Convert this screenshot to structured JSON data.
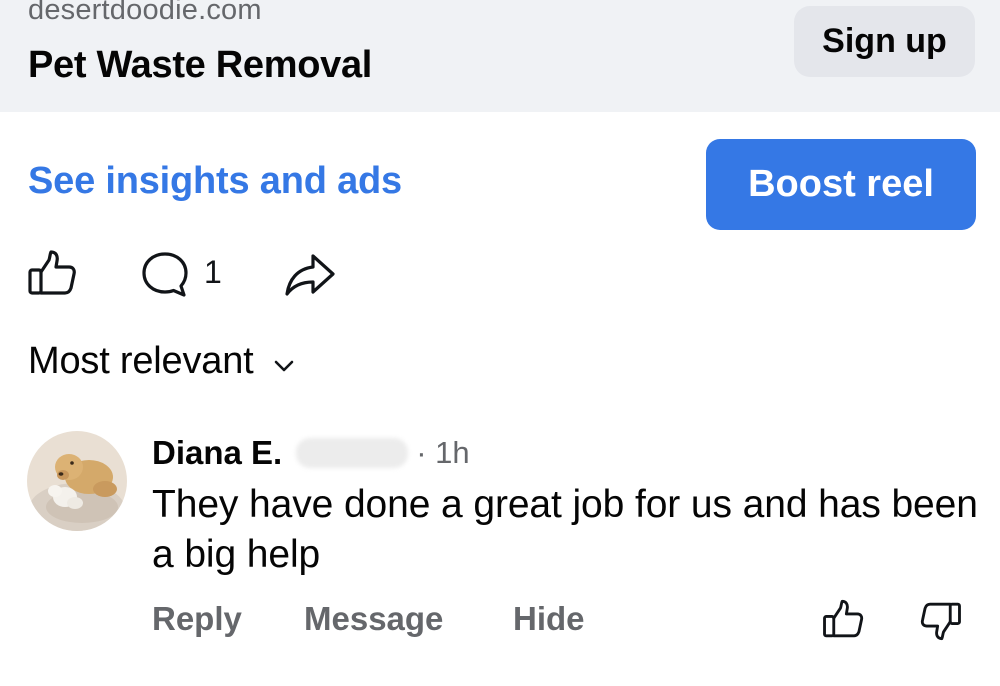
{
  "header": {
    "domain": "desertdoodie.com",
    "page_name": "Pet Waste Removal",
    "signup_label": "Sign up"
  },
  "actions_bar": {
    "insights_label": "See insights and ads",
    "boost_label": "Boost reel",
    "comment_count": "1",
    "icons": [
      "thumbs-up-icon",
      "comment-icon",
      "share-icon"
    ]
  },
  "sort": {
    "label": "Most relevant",
    "icon": "chevron-down-icon"
  },
  "comment": {
    "author": "Diana E.",
    "time": "· 1h",
    "text": "They have done a great job for us and has been a big help",
    "actions": {
      "reply": "Reply",
      "message": "Message",
      "hide": "Hide"
    },
    "icons": [
      "thumbs-up-icon",
      "thumbs-down-icon"
    ]
  },
  "colors": {
    "accent": "#3578e5",
    "header_bg": "#f0f2f5",
    "secondary_button_bg": "#e4e6eb",
    "muted_text": "#65676b"
  }
}
